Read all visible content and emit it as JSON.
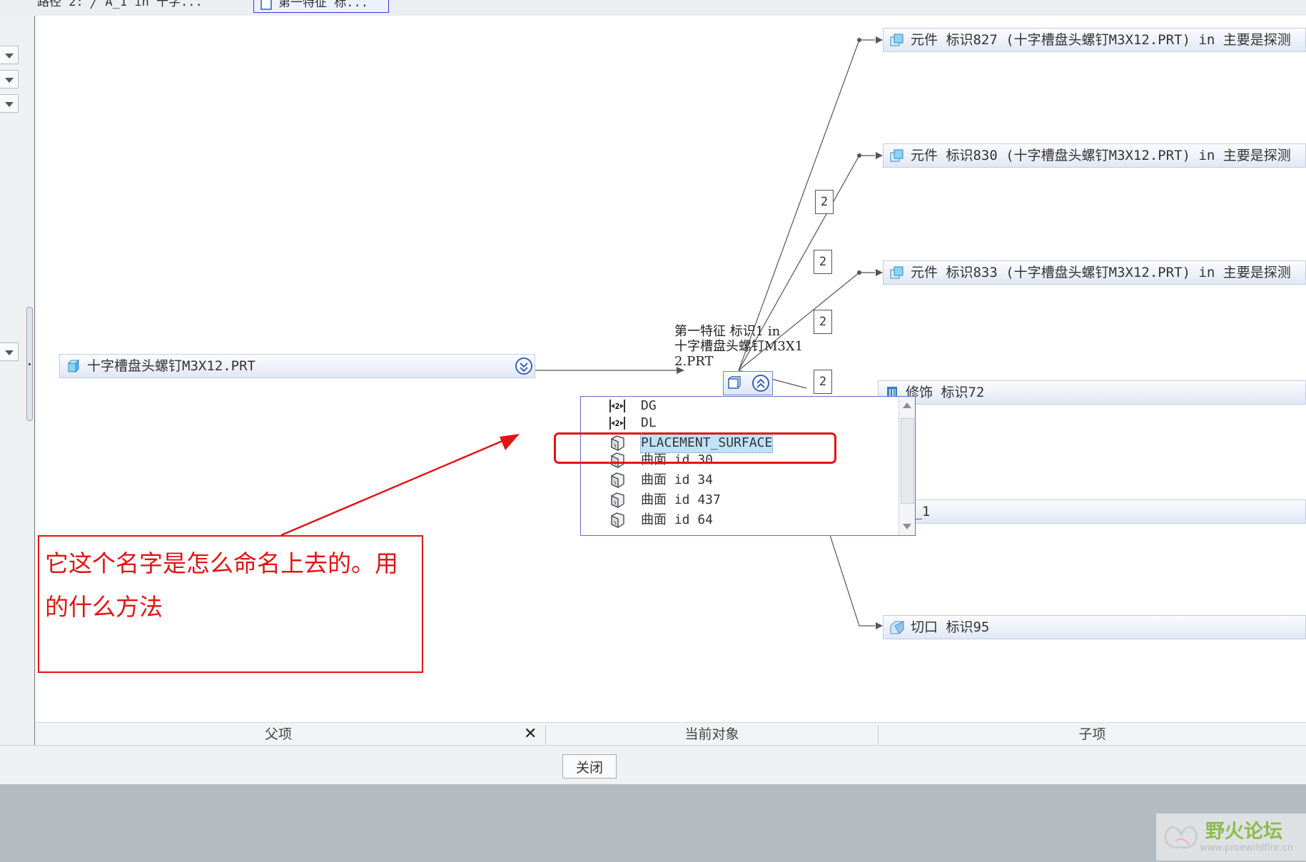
{
  "path_bar": {
    "text": "路径 2: ╱ A_1 in 十字...",
    "chip": "第一特征 标...",
    "icon": "feature-icon"
  },
  "parent": {
    "node_label": "十字槽盘头螺钉M3X12.PRT",
    "icon": "part-icon",
    "expand_icon": "double-chevron-down-icon"
  },
  "current": {
    "title": [
      "第一特征 标识1 in",
      "十字槽盘头螺钉M3X1",
      "2.PRT"
    ],
    "icon": "feature-icon",
    "collapse_icon": "double-chevron-up-icon",
    "list": [
      {
        "label": "DG",
        "icon": "dimension-icon"
      },
      {
        "label": "DL",
        "icon": "dimension-icon"
      },
      {
        "label": "PLACEMENT_SURFACE",
        "icon": "surface-icon",
        "selected": true
      },
      {
        "label": "曲面 id 30",
        "icon": "surface-icon"
      },
      {
        "label": "曲面 id 34",
        "icon": "surface-icon"
      },
      {
        "label": "曲面 id 437",
        "icon": "surface-icon"
      },
      {
        "label": "曲面 id 64",
        "icon": "surface-icon"
      }
    ]
  },
  "children": [
    {
      "label": "元件 标识827 (十字槽盘头螺钉M3X12.PRT) in 主要是探测",
      "icon": "component-icon"
    },
    {
      "label": "元件 标识830 (十字槽盘头螺钉M3X12.PRT) in 主要是探测",
      "icon": "component-icon"
    },
    {
      "label": "元件 标识833 (十字槽盘头螺钉M3X12.PRT) in 主要是探测",
      "icon": "component-icon"
    },
    {
      "label": "修饰 标识72",
      "icon": "cosmetic-icon"
    },
    {
      "label": "A_1",
      "icon": "axis-icon"
    },
    {
      "label": "切口 标识95",
      "icon": "cut-icon"
    }
  ],
  "counts": [
    "2",
    "2",
    "2",
    "2"
  ],
  "annotation": {
    "lines": [
      "它这个名字是怎么命名上去的。用",
      "的什么方法"
    ],
    "color": "#e11414"
  },
  "column_headers": {
    "parents": "父项",
    "current": "当前对象",
    "children": "子项",
    "close_icon": "close-x-icon"
  },
  "buttons": {
    "close": "关闭"
  },
  "watermark": {
    "title": "野火论坛",
    "url": "www.proewildfire.cn"
  },
  "colors": {
    "accent": "#3a5fb8",
    "selection": "#bfe3f6",
    "node_fill": "#e1e8f4",
    "annotation": "#e11414"
  }
}
